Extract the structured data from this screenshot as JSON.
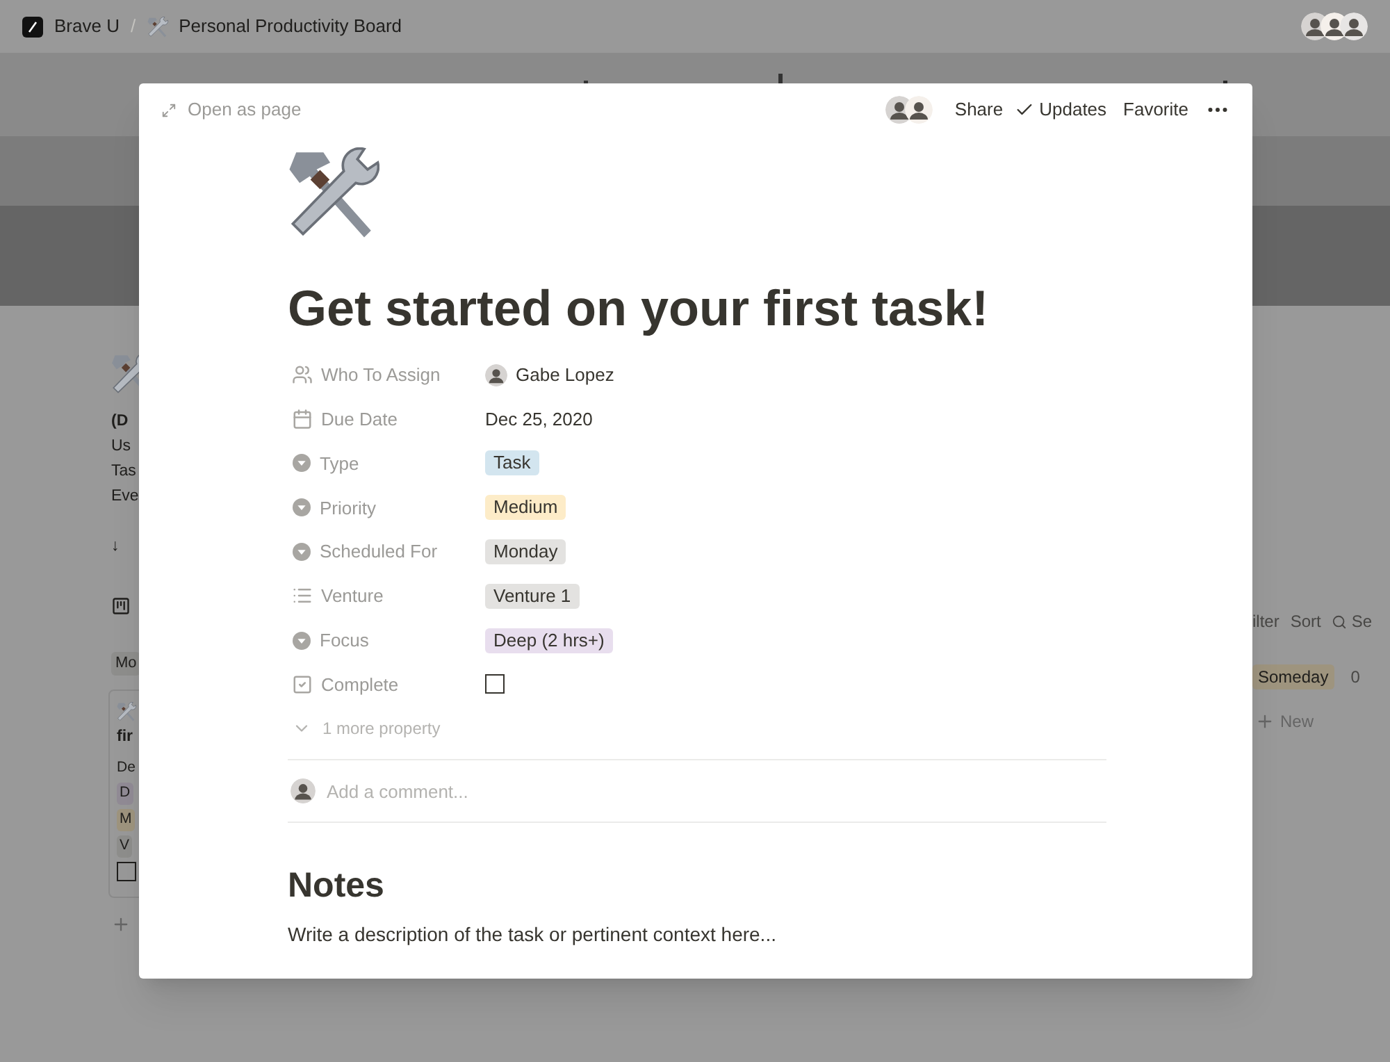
{
  "background": {
    "breadcrumb": [
      {
        "label": "Brave U"
      },
      {
        "label": "Personal Productivity Board"
      }
    ],
    "separator": "/",
    "intro": {
      "bold": "(D",
      "lines": [
        "Us",
        "Tas",
        "Eve"
      ]
    },
    "jump": "↓",
    "group_left": {
      "label": "Mo",
      "color": "#8e8e8c"
    },
    "card": {
      "title": "fir",
      "property": "De",
      "tags": [
        {
          "label": "D",
          "color": "#918b95"
        },
        {
          "label": "M",
          "color": "#9e947e"
        },
        {
          "label": "V",
          "color": "#8e8e8c"
        }
      ],
      "checked": false
    },
    "toolbar": [
      "ilter",
      "Sort",
      "Se"
    ],
    "group_right": {
      "label": "Someday",
      "count": "0",
      "color": "#9e947e"
    },
    "new_label": "New"
  },
  "modal": {
    "open_as_page": "Open as page",
    "share": "Share",
    "updates": "Updates",
    "favorite": "Favorite",
    "title": "Get started on your first task!",
    "properties": [
      {
        "kind": "person",
        "label": "Who To Assign",
        "value": "Gabe Lopez"
      },
      {
        "kind": "date",
        "label": "Due Date",
        "value": "Dec 25, 2020"
      },
      {
        "kind": "select",
        "label": "Type",
        "value": "Task",
        "color": "#d3e5ef"
      },
      {
        "kind": "select",
        "label": "Priority",
        "value": "Medium",
        "color": "#fdecc8"
      },
      {
        "kind": "select",
        "label": "Scheduled For",
        "value": "Monday",
        "color": "#e3e2e0"
      },
      {
        "kind": "multi_select",
        "label": "Venture",
        "value": "Venture 1",
        "color": "#e3e2e0"
      },
      {
        "kind": "select",
        "label": "Focus",
        "value": "Deep (2 hrs+)",
        "color": "#e8deee"
      },
      {
        "kind": "checkbox",
        "label": "Complete",
        "checked": false
      }
    ],
    "more": "1 more property",
    "comment_placeholder": "Add a comment...",
    "notes_heading": "Notes",
    "notes_text": "Write a description of the task or pertinent context here..."
  }
}
